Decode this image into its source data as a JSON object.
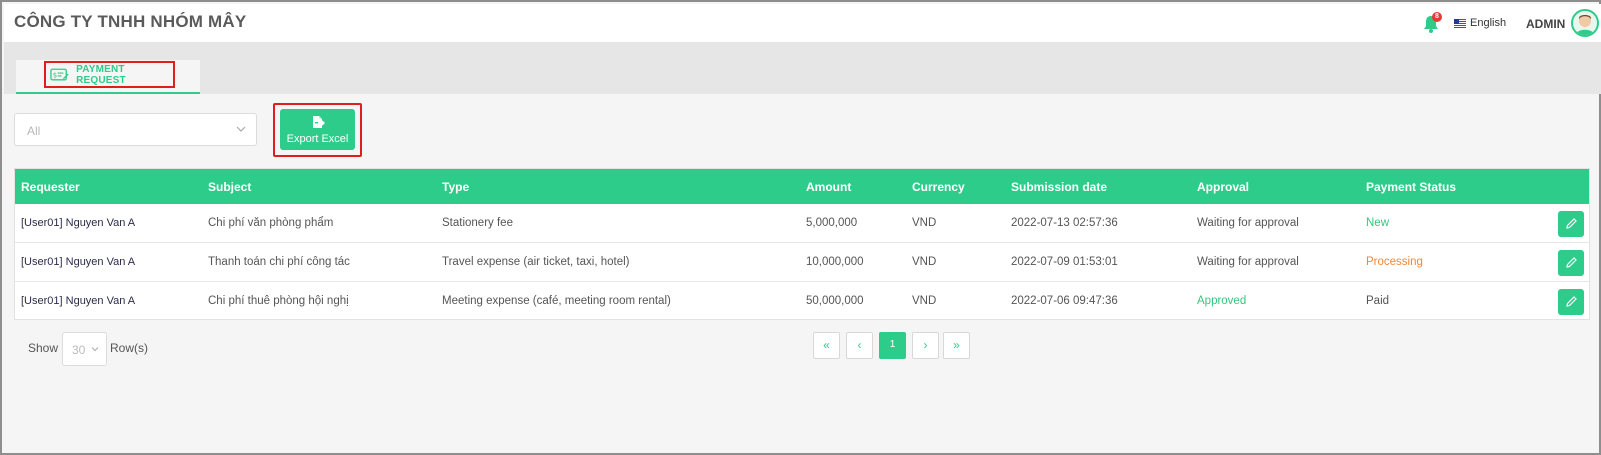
{
  "header": {
    "company": "CÔNG TY TNHH NHÓM MÂY",
    "notification_count": "8",
    "language": "English",
    "user": "ADMIN"
  },
  "tabs": [
    {
      "label": "PAYMENT REQUEST",
      "icon": "payment-request-icon"
    }
  ],
  "filter": {
    "value": "All"
  },
  "export": {
    "label": "Export Excel",
    "icon": "excel-export-icon"
  },
  "table": {
    "columns": [
      "Requester",
      "Subject",
      "Type",
      "Amount",
      "Currency",
      "Submission date",
      "Approval",
      "Payment Status"
    ],
    "rows": [
      {
        "requester": "[User01] Nguyen Van A",
        "subject": "Chi phí văn phòng phẩm",
        "type": "Stationery fee",
        "amount": "5,000,000",
        "currency": "VND",
        "submission_date": "2022-07-13 02:57:36",
        "approval": "Waiting for approval",
        "payment_status": "New"
      },
      {
        "requester": "[User01] Nguyen Van A",
        "subject": "Thanh toán chi phí công tác",
        "type": "Travel expense (air ticket, taxi, hotel)",
        "amount": "10,000,000",
        "currency": "VND",
        "submission_date": "2022-07-09 01:53:01",
        "approval": "Waiting for approval",
        "payment_status": "Processing"
      },
      {
        "requester": "[User01] Nguyen Van A",
        "subject": "Chi phí thuê phòng hội nghị",
        "type": "Meeting expense (café, meeting room rental)",
        "amount": "50,000,000",
        "currency": "VND",
        "submission_date": "2022-07-06 09:47:36",
        "approval": "Approved",
        "payment_status": "Paid"
      }
    ]
  },
  "pagination": {
    "show_label": "Show",
    "rows_value": "30",
    "rows_label": "Row(s)",
    "first": "«",
    "prev": "‹",
    "current": "1",
    "next": "›",
    "last": "»"
  },
  "colors": {
    "accent": "#2ecc8a",
    "highlight_border": "#e01e1e",
    "processing": "#f0883a"
  }
}
